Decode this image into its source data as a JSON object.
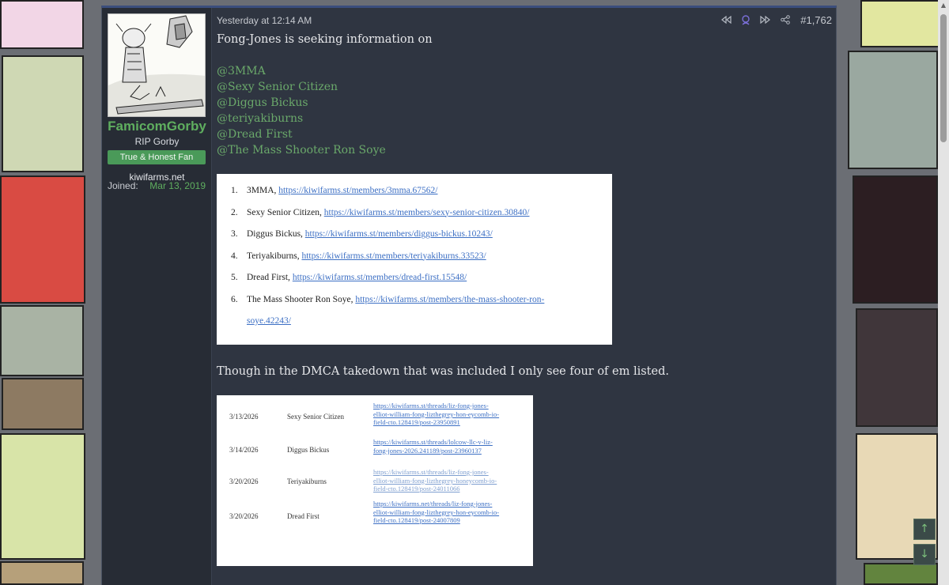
{
  "user": {
    "name": "FamicomGorby",
    "title": "RIP Gorby",
    "banner": "True & Honest Fan",
    "site": "kiwifarms.net",
    "joined_label": "Joined:",
    "joined_value": "Mar 13, 2019"
  },
  "post": {
    "date": "Yesterday at 12:14 AM",
    "number": "#1,762",
    "intro": "Fong-Jones is seeking information on",
    "mentions": [
      "@3MMA",
      "@Sexy Senior Citizen",
      "@Diggus Bickus",
      "@teriyakiburns",
      "@Dread First",
      "@The Mass Shooter Ron Soye"
    ],
    "after_text": "Though in the DMCA takedown that was included I only see four of em listed."
  },
  "shot1": {
    "items": [
      {
        "num": "1.",
        "name": "3MMA,",
        "url": "https://kiwifarms.st/members/3mma.67562/"
      },
      {
        "num": "2.",
        "name": "Sexy Senior Citizen,",
        "url": "https://kiwifarms.st/members/sexy-senior-citizen.30840/"
      },
      {
        "num": "3.",
        "name": "Diggus Bickus,",
        "url": "https://kiwifarms.st/members/diggus-bickus.10243/"
      },
      {
        "num": "4.",
        "name": "Teriyakiburns,",
        "url": "https://kiwifarms.st/members/teriyakiburns.33523/"
      },
      {
        "num": "5.",
        "name": "Dread First,",
        "url": "https://kiwifarms.st/members/dread-first.15548/"
      },
      {
        "num": "6.",
        "name": "The Mass Shooter Ron Soye,",
        "url": "https://kiwifarms.st/members/the-mass-shooter-ron-",
        "url_cont": "soye.42243/"
      }
    ]
  },
  "shot2": {
    "rows": [
      {
        "date": "3/13/2026",
        "name": "Sexy Senior Citizen",
        "url": "https://kiwifarms.st/threads/liz-fong-jones-elliot-william-fong-lizthegrey-hon-eycomb-io-field-cto.128419/post-23950891"
      },
      {
        "date": "3/14/2026",
        "name": "Diggus Bickus",
        "url": "https://kiwifarms.st/threads/lolcow-llc-v-liz-fong-jones-2026.241189/post-23960137"
      },
      {
        "date": "3/20/2026",
        "name": "Teriyakiburns",
        "url": "https://kiwifarms.st/threads/liz-fong-jones-elliot-william-fong-lizthegrey-honeycomb-io-field-cto.128419/post-24011066"
      },
      {
        "date": "3/20/2026",
        "name": "Dread First",
        "url": "https://kiwifarms.net/threads/liz-fong-jones-elliot-william-fong-lizthegrey-hon-eycomb-io-field-cto.128419/post-24007809"
      }
    ]
  },
  "icons": {
    "prev": "rewind-icon",
    "ignore": "user-circle-icon",
    "next": "fast-forward-icon",
    "share": "share-icon",
    "jump_up": "arrow-up-icon",
    "jump_down": "arrow-down-icon"
  },
  "colors": {
    "accent_green": "#5fae5f",
    "mention_green": "#6aa86a",
    "link_blue": "#3c6fc4",
    "post_bg": "#2f3541"
  }
}
